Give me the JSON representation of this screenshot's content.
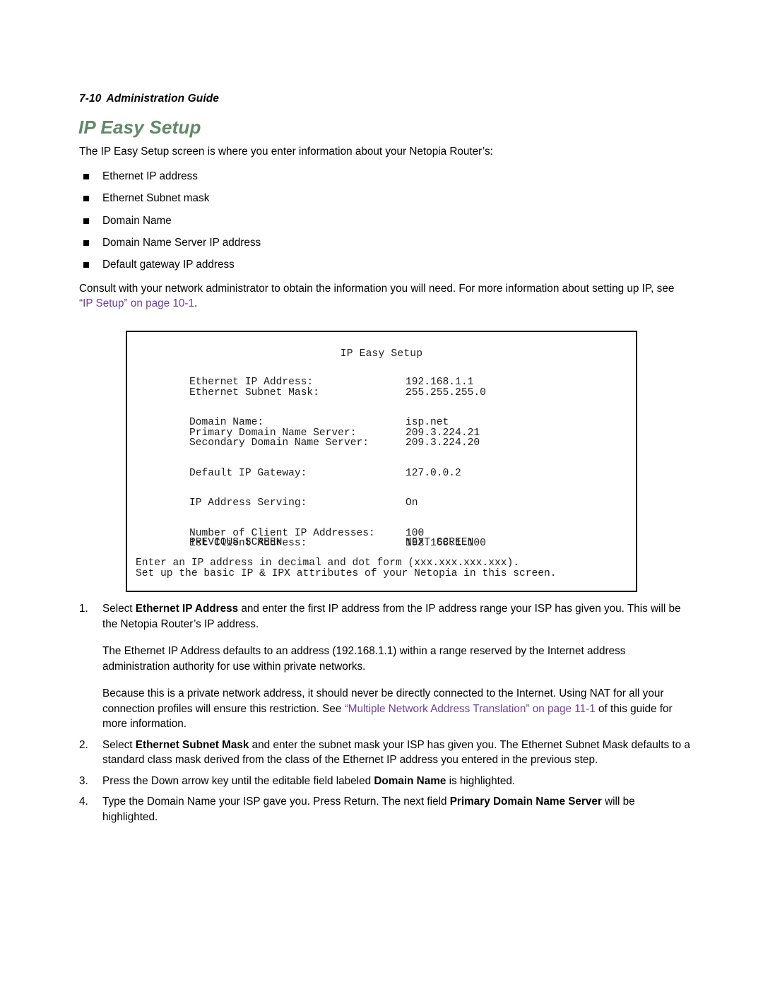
{
  "header": {
    "folio": "7-10",
    "guide_title": "Administration Guide"
  },
  "section": {
    "heading": "IP Easy Setup",
    "intro": "The IP Easy Setup screen is where you enter information about your Netopia Router’s:"
  },
  "bullets": [
    "Ethernet IP address",
    "Ethernet Subnet mask",
    "Domain Name",
    "Domain Name Server IP address",
    "Default gateway IP address"
  ],
  "consult": {
    "before_link": "Consult with your network administrator to obtain the information you will need. For more information about setting up IP, see ",
    "link_text": "“IP Setup” on page 10-1",
    "after_link": "."
  },
  "terminal": {
    "title": "IP Easy Setup",
    "rows": [
      {
        "label": "Ethernet IP Address:",
        "value": "192.168.1.1",
        "gap_before": false
      },
      {
        "label": "Ethernet Subnet Mask:",
        "value": "255.255.255.0",
        "gap_before": false
      },
      {
        "label": "Domain Name:",
        "value": "isp.net",
        "gap_before": true
      },
      {
        "label": "Primary Domain Name Server:",
        "value": "209.3.224.21",
        "gap_before": false
      },
      {
        "label": "Secondary Domain Name Server:",
        "value": "209.3.224.20",
        "gap_before": false
      },
      {
        "label": "Default IP Gateway:",
        "value": "127.0.0.2",
        "gap_before": true
      },
      {
        "label": "IP Address Serving:",
        "value": "On",
        "gap_before": true
      },
      {
        "label": "Number of Client IP Addresses:",
        "value": "100",
        "gap_before": true
      },
      {
        "label": "1st Client Address:",
        "value": "192.168.1.100",
        "gap_before": false
      }
    ],
    "nav": {
      "previous": "PREVIOUS SCREEN",
      "next": "NEXT SCREEN"
    },
    "help_lines": [
      "Enter an IP address in decimal and dot form (xxx.xxx.xxx.xxx).",
      "Set up the basic IP & IPX attributes of your Netopia in this screen."
    ]
  },
  "steps": [
    {
      "num": "1.",
      "segments": [
        {
          "text": "Select ",
          "bold": false
        },
        {
          "text": "Ethernet IP Address",
          "bold": true
        },
        {
          "text": " and enter the first IP address from the IP address range your ISP has given you. This will be the Netopia Router’s IP address.",
          "bold": false
        }
      ],
      "sub_paragraphs": [
        {
          "segments": [
            {
              "text": "The Ethernet IP Address defaults to an address (192.168.1.1) within a range reserved by the Internet address administration authority for use within private networks.",
              "bold": false
            }
          ]
        },
        {
          "segments": [
            {
              "text": "Because this is a private network address, it should never be directly connected to the Internet. Using NAT for all your connection profiles will ensure this restriction. See ",
              "bold": false
            },
            {
              "text": "“Multiple Network Address Translation” on page 11-1",
              "bold": false,
              "link": true
            },
            {
              "text": " of this guide for more information.",
              "bold": false
            }
          ]
        }
      ]
    },
    {
      "num": "2.",
      "segments": [
        {
          "text": "Select ",
          "bold": false
        },
        {
          "text": "Ethernet Subnet Mask",
          "bold": true
        },
        {
          "text": " and enter the subnet mask your ISP has given you. The Ethernet Subnet Mask defaults to a standard class mask derived from the class of the Ethernet IP address you entered in the previous step.",
          "bold": false
        }
      ],
      "sub_paragraphs": []
    },
    {
      "num": "3.",
      "segments": [
        {
          "text": "Press the Down arrow key until the editable field labeled ",
          "bold": false
        },
        {
          "text": "Domain Name",
          "bold": true
        },
        {
          "text": " is highlighted.",
          "bold": false
        }
      ],
      "sub_paragraphs": []
    },
    {
      "num": "4.",
      "segments": [
        {
          "text": "Type the Domain Name your ISP gave you. Press Return. The next field ",
          "bold": false
        },
        {
          "text": "Primary Domain Name Server",
          "bold": true
        },
        {
          "text": " will be highlighted.",
          "bold": false
        }
      ],
      "sub_paragraphs": []
    }
  ],
  "colors": {
    "heading_green": "#5f8a66",
    "link_purple": "#6b3fa0",
    "terminal_border": "#111111"
  }
}
